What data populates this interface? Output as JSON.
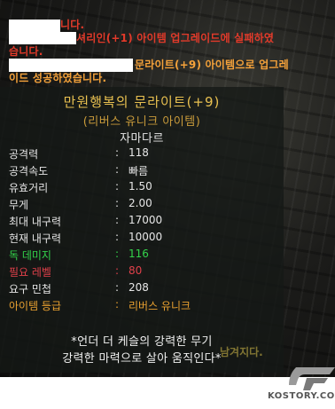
{
  "messages": [
    {
      "text": "니다.",
      "color": "#e23a2a"
    },
    {
      "text": "셔리인(+1) 아이템 업그레이드에 실패하였",
      "color": "#e23a2a"
    },
    {
      "text": "습니다.",
      "color": "#e23a2a"
    },
    {
      "text": "문라이트(+9) 아이템으로 업그레",
      "color": "#f5a23a"
    },
    {
      "text": "이드 성공하였습니다.",
      "color": "#f5a23a"
    }
  ],
  "tooltip": {
    "title": "만원행복의 문라이트(+9)",
    "subtitle": "(리버스 유니크 아이템)",
    "name": "자마다르",
    "stats": [
      {
        "label": "공격력",
        "value": "118",
        "color": "#e6e6e6"
      },
      {
        "label": "공격속도",
        "value": "빠름",
        "color": "#e6e6e6"
      },
      {
        "label": "유효거리",
        "value": "1.50",
        "color": "#e6e6e6"
      },
      {
        "label": "무게",
        "value": "2.00",
        "color": "#e6e6e6"
      },
      {
        "label": "최대 내구력",
        "value": "17000",
        "color": "#e6e6e6"
      },
      {
        "label": "현재 내구력",
        "value": "10000",
        "color": "#e6e6e6"
      },
      {
        "label": "독 데미지",
        "value": "116",
        "color": "#33d24a"
      },
      {
        "label": "필요 레벨",
        "value": "80",
        "color": "#e0404a"
      },
      {
        "label": "요구 민첩",
        "value": "208",
        "color": "#e6e6e6"
      },
      {
        "label": "아이템 등급",
        "value": "리버스 유니크",
        "color": "#e8a030"
      }
    ],
    "colon": ":",
    "description": [
      "*언더 더 케슬의 강력한 무기",
      "강력한 마력으로 살아 움직인다*"
    ]
  },
  "watermark": {
    "text": "남겨지다."
  },
  "logo": {
    "text": "KOSTORY.COM"
  }
}
